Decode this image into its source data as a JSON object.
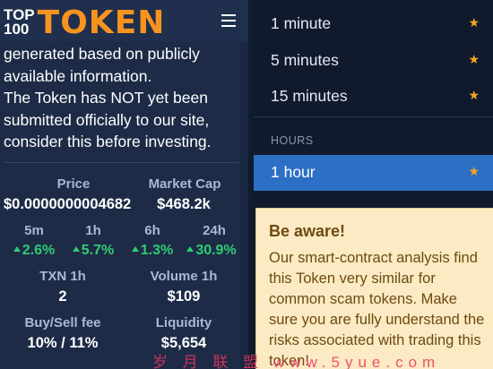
{
  "header": {
    "logo_top": "TOP",
    "logo_num": "100",
    "logo_big": "TOKEN"
  },
  "notice": {
    "line1": "generated based on publicly",
    "line2": "available information.",
    "line3": "The Token has NOT yet been",
    "line4": "submitted officially to our site,",
    "line5": "consider this before investing."
  },
  "stats": {
    "price_label": "Price",
    "price_value": "$0.0000000004682",
    "mcap_label": "Market Cap",
    "mcap_value": "$468.2k",
    "changes": [
      {
        "label": "5m",
        "value": "2.6%"
      },
      {
        "label": "1h",
        "value": "5.7%"
      },
      {
        "label": "6h",
        "value": "1.3%"
      },
      {
        "label": "24h",
        "value": "30.9%"
      }
    ],
    "txn_label": "TXN 1h",
    "txn_value": "2",
    "volume_label": "Volume 1h",
    "volume_value": "$109",
    "fee_label": "Buy/Sell fee",
    "fee_value": "10% / 11%",
    "liquidity_label": "Liquidity",
    "liquidity_value": "$5,654"
  },
  "dropdown": {
    "items": [
      {
        "label": "1 minute"
      },
      {
        "label": "5 minutes"
      },
      {
        "label": "15 minutes"
      }
    ],
    "group_label": "HOURS",
    "selected": {
      "label": "1 hour"
    },
    "star_icon": "star-icon"
  },
  "warning": {
    "title": "Be aware!",
    "body": "Our smart-contract analysis find this Token very similar for common scam tokens. Make sure you are fully understand the risks associated with trading this token!"
  },
  "watermark": "岁 月 联 盟  www.5yue.com",
  "colors": {
    "accent": "#f7931e",
    "positive": "#2ecc71",
    "selected": "#2d6fc4",
    "warning_bg": "#fbeac3",
    "warning_text": "#6d4b12",
    "star": "#f5a623"
  }
}
